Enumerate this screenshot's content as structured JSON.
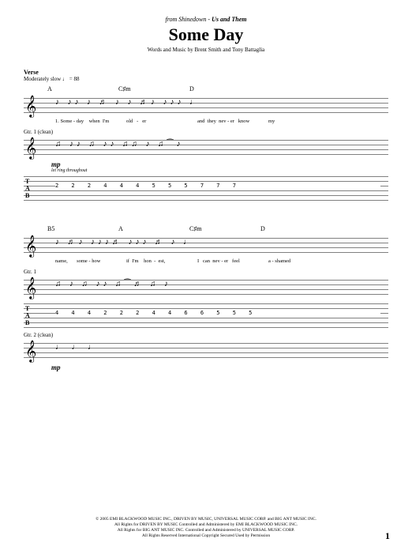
{
  "header": {
    "source_prefix": "from Shinedown - ",
    "album": "Us and Them",
    "title": "Some Day",
    "credits": "Words and Music by Brent Smith and Tony Battaglia"
  },
  "section": {
    "label": "Verse",
    "tempo": "Moderately slow ♩ = 88"
  },
  "system1": {
    "chords": [
      "A",
      "C♯m",
      "D",
      ""
    ],
    "lyrics": [
      "1. Some - day    when  I'm",
      "old   -   er",
      "and  they  nev - er   know",
      "my"
    ],
    "part": "Gtr. 1 (clean)",
    "dynamic": "mp",
    "technique": "let ring throughout",
    "tab_numbers": "2  2 2   4 4 4   5 5 5   7 7 7"
  },
  "system2": {
    "chords": [
      "B5",
      "A",
      "C♯m",
      "D"
    ],
    "lyrics": [
      "name,       some - how",
      "if  I'm    hon  -  est,",
      "I   can  nev - er   feel",
      "a - shamed"
    ],
    "part1": "Gtr. 1",
    "tab_numbers": "4 4 4   2 2 2   4 4 6 6   5 5 5",
    "part2": "Gtr. 2 (clean)",
    "dynamic2": "mp"
  },
  "copyright": {
    "line1": "© 2005 EMI BLACKWOOD MUSIC INC., DRIVEN BY MUSIC, UNIVERSAL MUSIC CORP. and BIG ANT MUSIC INC.",
    "line2": "All Rights for DRIVEN BY MUSIC Controlled and Administered by EMI BLACKWOOD MUSIC INC.",
    "line3": "All Rights for BIG ANT MUSIC INC. Controlled and Administered by UNIVERSAL MUSIC CORP.",
    "line4": "All Rights Reserved  International Copyright Secured  Used by Permission"
  },
  "page_number": "1"
}
